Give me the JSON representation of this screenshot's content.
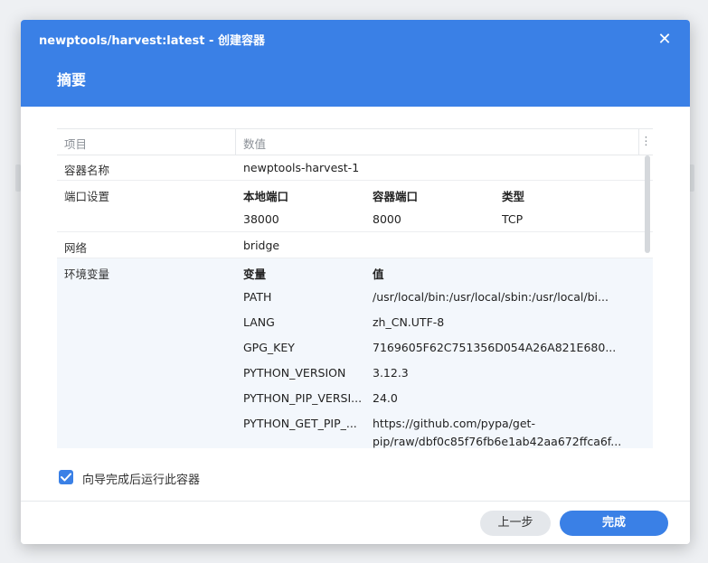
{
  "window": {
    "title": "newptools/harvest:latest - 创建容器",
    "close_glyph": "✕"
  },
  "page": {
    "heading": "摘要"
  },
  "table": {
    "header": {
      "item": "项目",
      "value": "数值",
      "more_glyph": "⋮"
    },
    "container_name": {
      "label": "容器名称",
      "value": "newptools-harvest-1"
    },
    "ports": {
      "label": "端口设置",
      "headers": [
        "本地端口",
        "容器端口",
        "类型"
      ],
      "rows": [
        [
          "38000",
          "8000",
          "TCP"
        ]
      ]
    },
    "network": {
      "label": "网络",
      "value": "bridge"
    },
    "env": {
      "label": "环境变量",
      "headers": [
        "变量",
        "值"
      ],
      "rows": [
        [
          "PATH",
          "/usr/local/bin:/usr/local/sbin:/usr/local/bi..."
        ],
        [
          "LANG",
          "zh_CN.UTF-8"
        ],
        [
          "GPG_KEY",
          "7169605F62C751356D054A26A821E680..."
        ],
        [
          "PYTHON_VERSION",
          "3.12.3"
        ],
        [
          "PYTHON_PIP_VERSI...",
          "24.0"
        ],
        [
          "PYTHON_GET_PIP_...",
          "https://github.com/pypa/get-",
          "pip/raw/dbf0c85f76fb6e1ab42aa672ffca6f..."
        ]
      ]
    }
  },
  "options": {
    "run_after_wizard": {
      "label": "向导完成后运行此容器",
      "checked": true
    }
  },
  "footer": {
    "prev_label": "上一步",
    "done_label": "完成"
  },
  "colors": {
    "accent": "#3a80e6"
  }
}
